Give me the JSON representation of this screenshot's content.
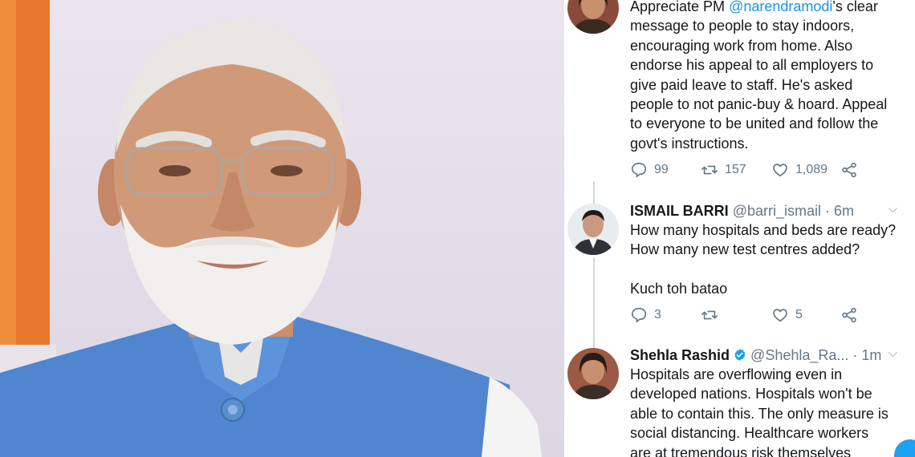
{
  "tweets": [
    {
      "text": "Appreciate PM @narendramodi's clear message to people to stay indoors, encouraging work from home. Also endorse his appeal to all employers to give paid leave to staff. He's asked people to not panic-buy & hoard. Appeal to everyone to be united and follow the govt's instructions.",
      "lines": [
        {
          "pre": "Appreciate PM ",
          "mention": "@narendramodi",
          "post": "'s clear"
        },
        "message to people to stay indoors,",
        "encouraging work from home. Also",
        "endorse his appeal to all employers to",
        "give paid leave to staff. He's asked",
        "people to not panic-buy & hoard. Appeal",
        "to everyone to be united and follow the",
        "govt's instructions."
      ],
      "replies": "99",
      "retweets": "157",
      "likes": "1,089"
    },
    {
      "name": "ISMAIL BARRI",
      "handle": "@barri_ismail",
      "separator": "·",
      "time": "6m",
      "lines": [
        "How many hospitals and beds are ready?",
        "How many new test centres added?"
      ],
      "lines2": [
        "Kuch toh batao"
      ],
      "replies": "3",
      "retweets": "",
      "likes": "5"
    },
    {
      "name": "Shehla Rashid",
      "handle": "@Shehla_Ra...",
      "separator": "·",
      "time": "1m",
      "lines": [
        "Hospitals are overflowing even in",
        "developed nations. Hospitals won't be",
        "able to contain this. The only measure is",
        "social distancing. Healthcare workers",
        "are at tremendous risk themselves"
      ]
    }
  ],
  "icons": {
    "reply": "reply-icon",
    "retweet": "retweet-icon",
    "like": "heart-icon",
    "share": "share-icon",
    "caret": "chevron-down-icon",
    "verified": "verified-badge-icon"
  },
  "colors": {
    "text": "#14171a",
    "muted": "#657786",
    "link": "#1b95e0",
    "verified": "#1da1f2"
  }
}
